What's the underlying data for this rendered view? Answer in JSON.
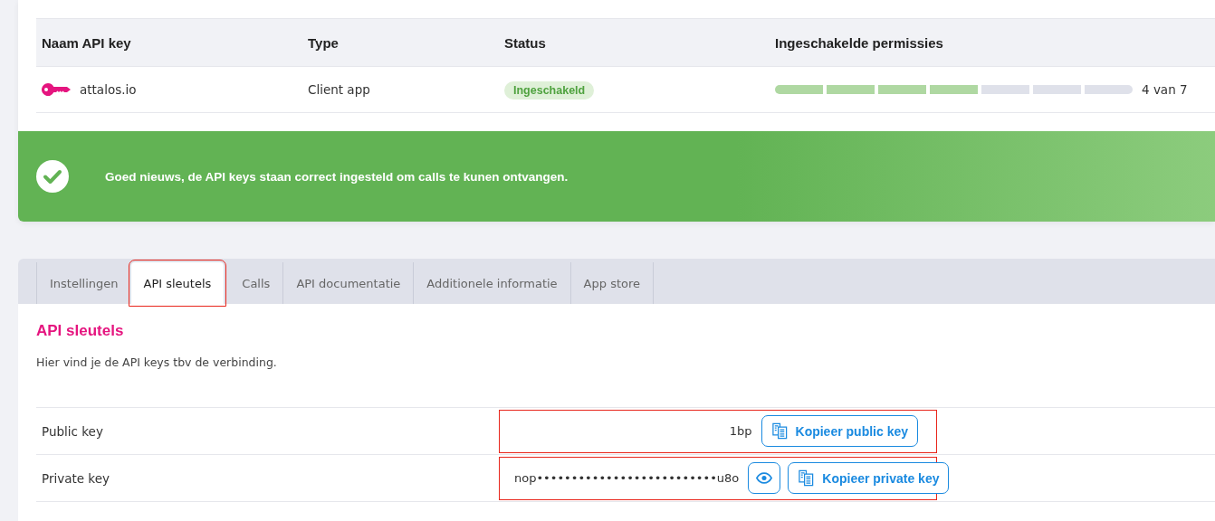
{
  "api_keys_table": {
    "columns": [
      "Naam API key",
      "Type",
      "Status",
      "Ingeschakelde permissies"
    ],
    "rows": [
      {
        "name": "attalos.io",
        "type": "Client app",
        "status": "Ingeschakeld",
        "permissions": [
          {
            "on": true
          },
          {
            "on": true
          },
          {
            "on": true
          },
          {
            "on": true
          },
          {
            "on": false
          },
          {
            "on": false
          },
          {
            "on": false
          }
        ],
        "permissions_count": "4 van 7"
      }
    ]
  },
  "banner": {
    "message": "Goed nieuws, de API keys staan correct ingesteld om calls te kunen ontvangen."
  },
  "tabs": [
    {
      "label": "Instellingen",
      "selected": false,
      "annotated": false
    },
    {
      "label": "API sleutels",
      "selected": true,
      "annotated": true
    },
    {
      "label": "Calls",
      "selected": false,
      "annotated": false
    },
    {
      "label": "API documentatie",
      "selected": false,
      "annotated": false
    },
    {
      "label": "Additionele informatie",
      "selected": false,
      "annotated": false
    },
    {
      "label": "App store",
      "selected": false,
      "annotated": false
    }
  ],
  "section": {
    "title": "API sleutels",
    "description": "Hier vind je de API keys tbv de verbinding."
  },
  "keys": [
    {
      "kind": "public",
      "label": "Public key",
      "value": "1bp",
      "copy_button": "Kopieer public key",
      "annotated": true
    },
    {
      "kind": "private",
      "label": "Private key",
      "value": "nop••••••••••••••••••••••••••u8o",
      "copy_button": "Kopieer private key",
      "annotated": true
    }
  ]
}
